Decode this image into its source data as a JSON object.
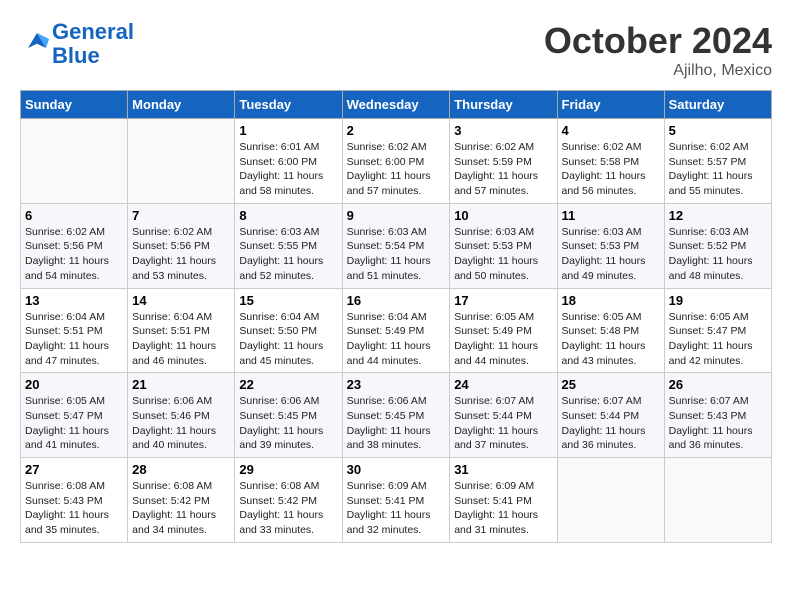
{
  "header": {
    "logo_line1": "General",
    "logo_line2": "Blue",
    "month_title": "October 2024",
    "location": "Ajilho, Mexico"
  },
  "days_of_week": [
    "Sunday",
    "Monday",
    "Tuesday",
    "Wednesday",
    "Thursday",
    "Friday",
    "Saturday"
  ],
  "weeks": [
    [
      {
        "day": "",
        "sunrise": "",
        "sunset": "",
        "daylight": ""
      },
      {
        "day": "",
        "sunrise": "",
        "sunset": "",
        "daylight": ""
      },
      {
        "day": "1",
        "sunrise": "Sunrise: 6:01 AM",
        "sunset": "Sunset: 6:00 PM",
        "daylight": "Daylight: 11 hours and 58 minutes."
      },
      {
        "day": "2",
        "sunrise": "Sunrise: 6:02 AM",
        "sunset": "Sunset: 6:00 PM",
        "daylight": "Daylight: 11 hours and 57 minutes."
      },
      {
        "day": "3",
        "sunrise": "Sunrise: 6:02 AM",
        "sunset": "Sunset: 5:59 PM",
        "daylight": "Daylight: 11 hours and 57 minutes."
      },
      {
        "day": "4",
        "sunrise": "Sunrise: 6:02 AM",
        "sunset": "Sunset: 5:58 PM",
        "daylight": "Daylight: 11 hours and 56 minutes."
      },
      {
        "day": "5",
        "sunrise": "Sunrise: 6:02 AM",
        "sunset": "Sunset: 5:57 PM",
        "daylight": "Daylight: 11 hours and 55 minutes."
      }
    ],
    [
      {
        "day": "6",
        "sunrise": "Sunrise: 6:02 AM",
        "sunset": "Sunset: 5:56 PM",
        "daylight": "Daylight: 11 hours and 54 minutes."
      },
      {
        "day": "7",
        "sunrise": "Sunrise: 6:02 AM",
        "sunset": "Sunset: 5:56 PM",
        "daylight": "Daylight: 11 hours and 53 minutes."
      },
      {
        "day": "8",
        "sunrise": "Sunrise: 6:03 AM",
        "sunset": "Sunset: 5:55 PM",
        "daylight": "Daylight: 11 hours and 52 minutes."
      },
      {
        "day": "9",
        "sunrise": "Sunrise: 6:03 AM",
        "sunset": "Sunset: 5:54 PM",
        "daylight": "Daylight: 11 hours and 51 minutes."
      },
      {
        "day": "10",
        "sunrise": "Sunrise: 6:03 AM",
        "sunset": "Sunset: 5:53 PM",
        "daylight": "Daylight: 11 hours and 50 minutes."
      },
      {
        "day": "11",
        "sunrise": "Sunrise: 6:03 AM",
        "sunset": "Sunset: 5:53 PM",
        "daylight": "Daylight: 11 hours and 49 minutes."
      },
      {
        "day": "12",
        "sunrise": "Sunrise: 6:03 AM",
        "sunset": "Sunset: 5:52 PM",
        "daylight": "Daylight: 11 hours and 48 minutes."
      }
    ],
    [
      {
        "day": "13",
        "sunrise": "Sunrise: 6:04 AM",
        "sunset": "Sunset: 5:51 PM",
        "daylight": "Daylight: 11 hours and 47 minutes."
      },
      {
        "day": "14",
        "sunrise": "Sunrise: 6:04 AM",
        "sunset": "Sunset: 5:51 PM",
        "daylight": "Daylight: 11 hours and 46 minutes."
      },
      {
        "day": "15",
        "sunrise": "Sunrise: 6:04 AM",
        "sunset": "Sunset: 5:50 PM",
        "daylight": "Daylight: 11 hours and 45 minutes."
      },
      {
        "day": "16",
        "sunrise": "Sunrise: 6:04 AM",
        "sunset": "Sunset: 5:49 PM",
        "daylight": "Daylight: 11 hours and 44 minutes."
      },
      {
        "day": "17",
        "sunrise": "Sunrise: 6:05 AM",
        "sunset": "Sunset: 5:49 PM",
        "daylight": "Daylight: 11 hours and 44 minutes."
      },
      {
        "day": "18",
        "sunrise": "Sunrise: 6:05 AM",
        "sunset": "Sunset: 5:48 PM",
        "daylight": "Daylight: 11 hours and 43 minutes."
      },
      {
        "day": "19",
        "sunrise": "Sunrise: 6:05 AM",
        "sunset": "Sunset: 5:47 PM",
        "daylight": "Daylight: 11 hours and 42 minutes."
      }
    ],
    [
      {
        "day": "20",
        "sunrise": "Sunrise: 6:05 AM",
        "sunset": "Sunset: 5:47 PM",
        "daylight": "Daylight: 11 hours and 41 minutes."
      },
      {
        "day": "21",
        "sunrise": "Sunrise: 6:06 AM",
        "sunset": "Sunset: 5:46 PM",
        "daylight": "Daylight: 11 hours and 40 minutes."
      },
      {
        "day": "22",
        "sunrise": "Sunrise: 6:06 AM",
        "sunset": "Sunset: 5:45 PM",
        "daylight": "Daylight: 11 hours and 39 minutes."
      },
      {
        "day": "23",
        "sunrise": "Sunrise: 6:06 AM",
        "sunset": "Sunset: 5:45 PM",
        "daylight": "Daylight: 11 hours and 38 minutes."
      },
      {
        "day": "24",
        "sunrise": "Sunrise: 6:07 AM",
        "sunset": "Sunset: 5:44 PM",
        "daylight": "Daylight: 11 hours and 37 minutes."
      },
      {
        "day": "25",
        "sunrise": "Sunrise: 6:07 AM",
        "sunset": "Sunset: 5:44 PM",
        "daylight": "Daylight: 11 hours and 36 minutes."
      },
      {
        "day": "26",
        "sunrise": "Sunrise: 6:07 AM",
        "sunset": "Sunset: 5:43 PM",
        "daylight": "Daylight: 11 hours and 36 minutes."
      }
    ],
    [
      {
        "day": "27",
        "sunrise": "Sunrise: 6:08 AM",
        "sunset": "Sunset: 5:43 PM",
        "daylight": "Daylight: 11 hours and 35 minutes."
      },
      {
        "day": "28",
        "sunrise": "Sunrise: 6:08 AM",
        "sunset": "Sunset: 5:42 PM",
        "daylight": "Daylight: 11 hours and 34 minutes."
      },
      {
        "day": "29",
        "sunrise": "Sunrise: 6:08 AM",
        "sunset": "Sunset: 5:42 PM",
        "daylight": "Daylight: 11 hours and 33 minutes."
      },
      {
        "day": "30",
        "sunrise": "Sunrise: 6:09 AM",
        "sunset": "Sunset: 5:41 PM",
        "daylight": "Daylight: 11 hours and 32 minutes."
      },
      {
        "day": "31",
        "sunrise": "Sunrise: 6:09 AM",
        "sunset": "Sunset: 5:41 PM",
        "daylight": "Daylight: 11 hours and 31 minutes."
      },
      {
        "day": "",
        "sunrise": "",
        "sunset": "",
        "daylight": ""
      },
      {
        "day": "",
        "sunrise": "",
        "sunset": "",
        "daylight": ""
      }
    ]
  ]
}
